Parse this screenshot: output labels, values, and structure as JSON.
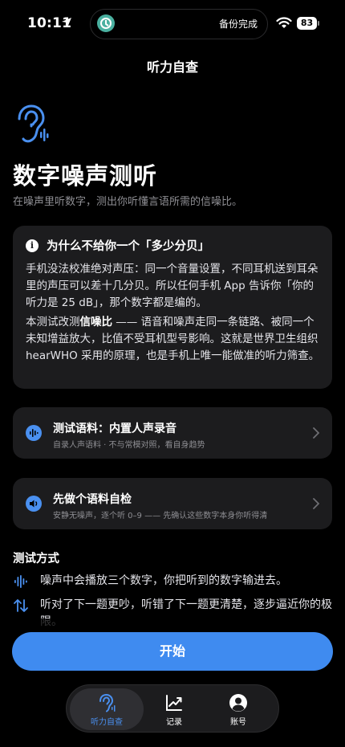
{
  "status_bar": {
    "time": "10:11",
    "island_text": "备份完成",
    "battery": "83",
    "icons": [
      "location-arrow-icon",
      "backup-app-icon",
      "wifi-icon",
      "battery-icon"
    ]
  },
  "nav": {
    "title": "听力自查"
  },
  "hero": {
    "icon": "ear-icon",
    "title": "数字噪声测听",
    "subtitle": "在噪声里听数字，测出你听懂言语所需的信噪比。"
  },
  "info_card": {
    "icon_glyph": "i",
    "title": "为什么不给你一个「多少分贝」",
    "p1": "手机没法校准绝对声压：同一个音量设置，不同耳机送到耳朵里的声压可以差十几分贝。所以任何手机 App 告诉你「你的听力是 25 dB」，那个数字都是编的。",
    "p2_prefix": "本测试改测",
    "p2_bold": "信噪比",
    "p2_rest": " —— 语音和噪声走同一条链路、被同一个未知增益放大，比值不受耳机型号影响。这就是世界卫生组织 hearWHO 采用的原理，也是手机上唯一能做准的听力筛查。"
  },
  "rows": [
    {
      "icon": "waveform-icon",
      "title": "测试语料：内置人声录音",
      "subtitle": "自录人声语料 · 不与常模对照，看自身趋势"
    },
    {
      "icon": "speaker-icon",
      "title": "先做个语料自检",
      "subtitle": "安静无噪声，逐个听 0–9 —— 先确认这些数字本身你听得清"
    }
  ],
  "method": {
    "title": "测试方式",
    "items": [
      {
        "icon": "waveform-icon",
        "text": "噪声中会播放三个数字，你把听到的数字输进去。"
      },
      {
        "icon": "up-down-arrows-icon",
        "text": "听对了下一题更吵，听错了下一题更清楚，逐步逼近你的极限。"
      }
    ]
  },
  "start_button": {
    "label": "开始"
  },
  "tabs": [
    {
      "icon": "ear-icon",
      "label": "听力自查",
      "active": true
    },
    {
      "icon": "chart-line-icon",
      "label": "记录",
      "active": false
    },
    {
      "icon": "account-icon",
      "label": "账号",
      "active": false
    }
  ],
  "colors": {
    "accent": "#3f8bf0",
    "card": "#1c1c1e",
    "background": "#000000",
    "secondary_text": "#8e8e93"
  }
}
